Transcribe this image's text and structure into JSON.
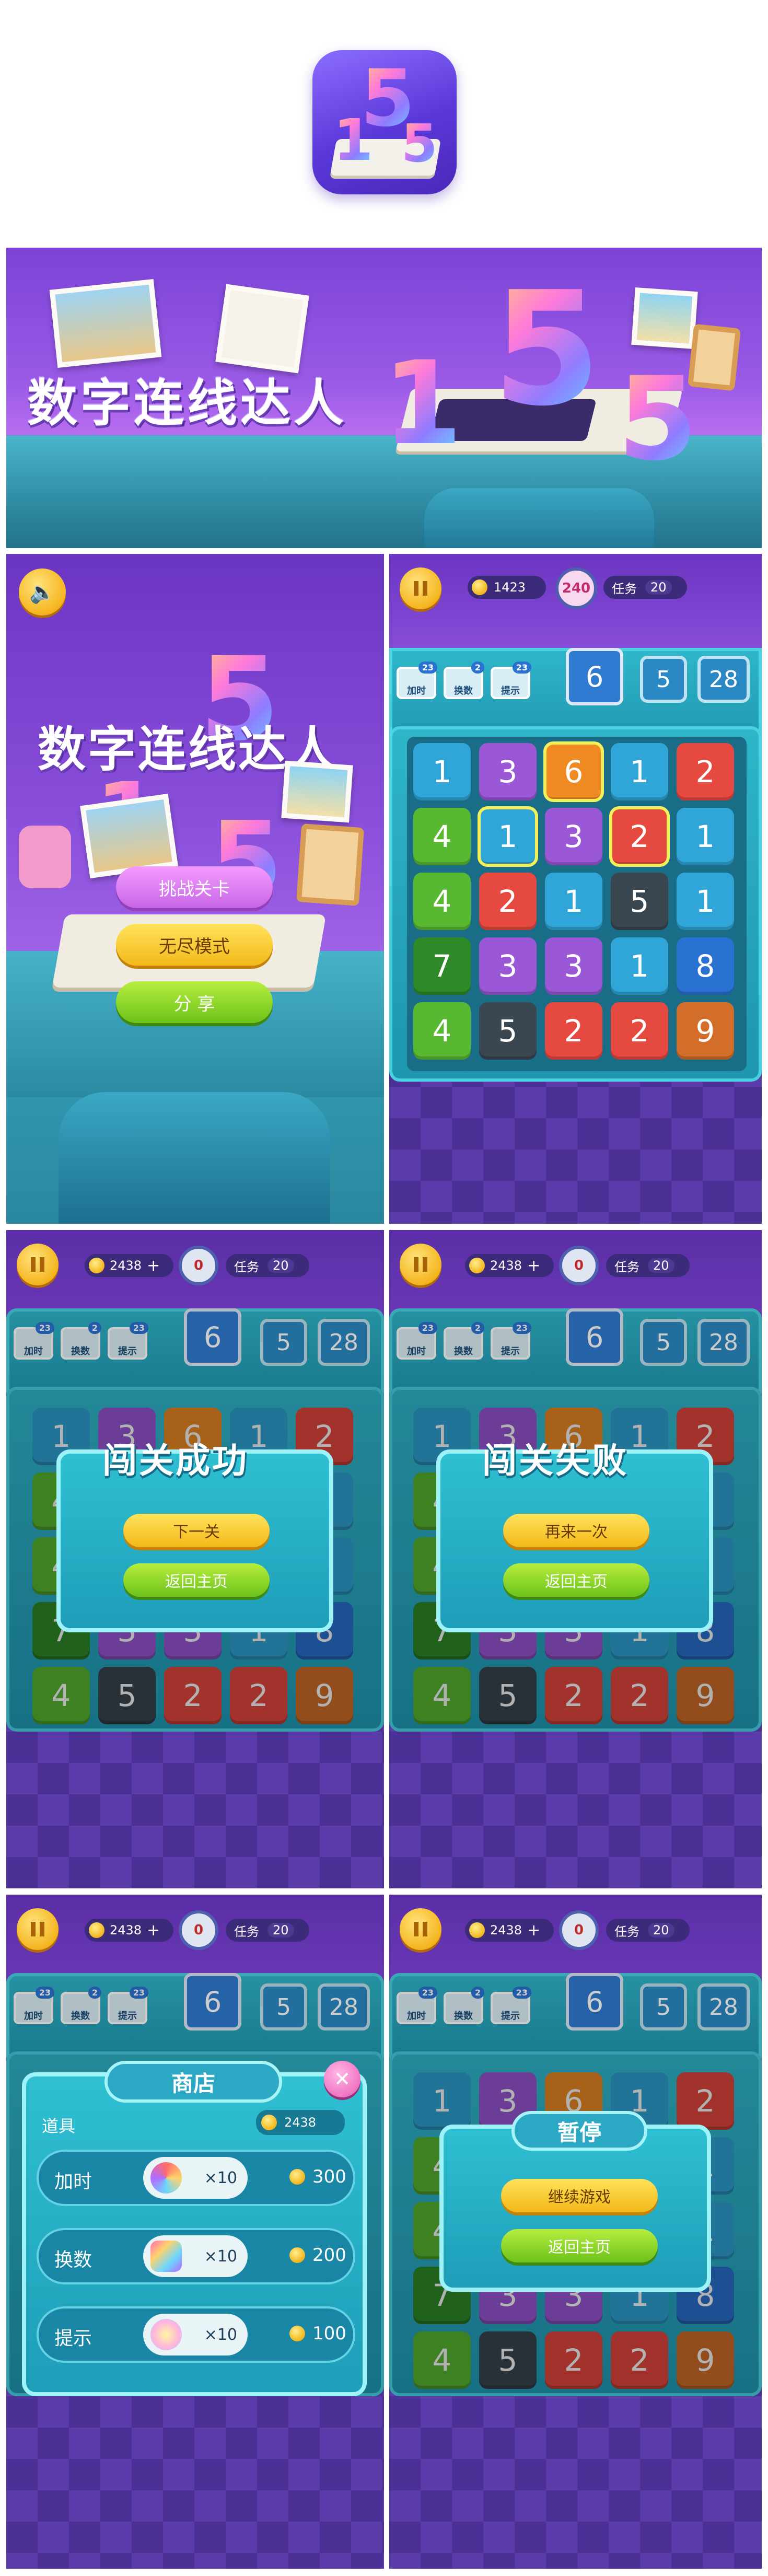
{
  "banner": {
    "title": "数字连线达人"
  },
  "home": {
    "title": "数字连线达人",
    "buttons": {
      "challenge": "挑战关卡",
      "endless": "无尽模式",
      "share": "分 享"
    }
  },
  "game": {
    "coins": "1423",
    "timer": "240",
    "task_label": "任务",
    "task_value": "20",
    "tools": [
      {
        "label": "加时",
        "count": "23"
      },
      {
        "label": "换数",
        "count": "2"
      },
      {
        "label": "提示",
        "count": "23"
      }
    ],
    "targets": [
      "6",
      "5",
      "28"
    ],
    "grid": [
      [
        "1",
        "3",
        "6",
        "1",
        "2"
      ],
      [
        "4",
        "1",
        "3",
        "2",
        "1"
      ],
      [
        "4",
        "2",
        "1",
        "5",
        "1"
      ],
      [
        "7",
        "3",
        "3",
        "1",
        "8"
      ],
      [
        "4",
        "5",
        "2",
        "2",
        "9"
      ]
    ]
  },
  "hud2": {
    "coins": "2438",
    "plus": "+",
    "timer": "0",
    "task_label": "任务",
    "task_value": "20"
  },
  "success": {
    "title": "闯关成功",
    "next": "下一关",
    "home": "返回主页"
  },
  "fail": {
    "title": "闯关失败",
    "retry": "再来一次",
    "home": "返回主页"
  },
  "shop": {
    "title": "商店",
    "section": "道具",
    "coins": "2438",
    "rows": [
      {
        "label": "加时",
        "qty": "×10",
        "price": "300"
      },
      {
        "label": "换数",
        "qty": "×10",
        "price": "200"
      },
      {
        "label": "提示",
        "qty": "×10",
        "price": "100"
      }
    ]
  },
  "pause": {
    "title": "暂停",
    "resume": "继续游戏",
    "home": "返回主页"
  },
  "colors": {
    "purple": "#8a4fdb",
    "teal": "#2fb5c9",
    "yellow": "#f3b91a",
    "green": "#6cc21a"
  }
}
